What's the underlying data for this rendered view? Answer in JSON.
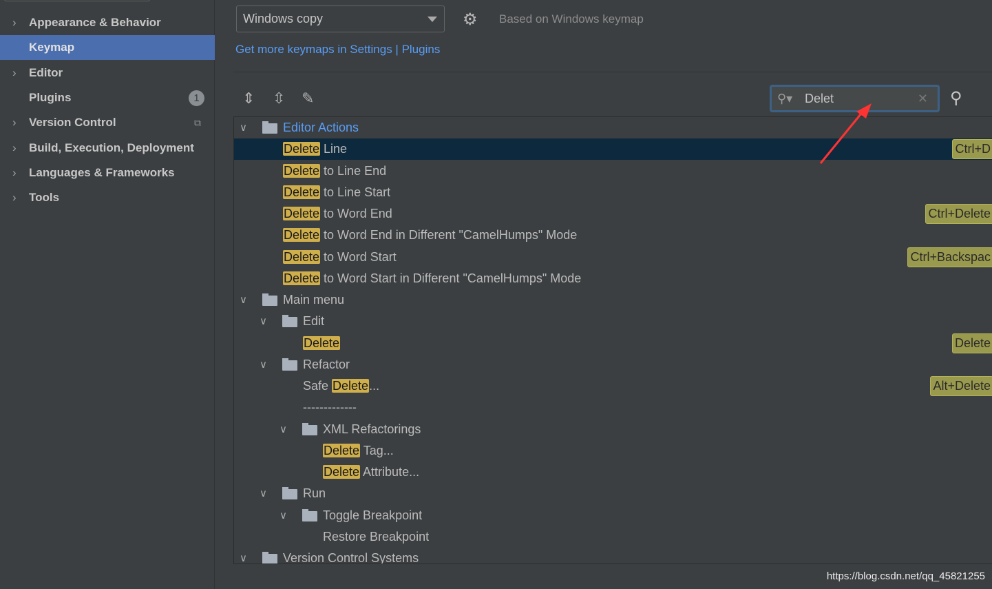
{
  "sidebar": {
    "items": [
      {
        "label": "Appearance & Behavior",
        "expandable": true
      },
      {
        "label": "Keymap",
        "selected": true
      },
      {
        "label": "Editor",
        "expandable": true
      },
      {
        "label": "Plugins",
        "badge": "1"
      },
      {
        "label": "Version Control",
        "expandable": true
      },
      {
        "label": "Build, Execution, Deployment",
        "expandable": true
      },
      {
        "label": "Languages & Frameworks",
        "expandable": true
      },
      {
        "label": "Tools",
        "expandable": true
      }
    ]
  },
  "keymap": {
    "selected": "Windows copy",
    "based_on": "Based on Windows keymap",
    "link": "Get more keymaps in Settings | Plugins"
  },
  "search": {
    "value": "Delet"
  },
  "tree": [
    {
      "level": 0,
      "type": "editor-folder",
      "text": "Editor Actions",
      "blue": true
    },
    {
      "level": 1,
      "type": "leaf",
      "hl": "Delete",
      "rest": " Line",
      "shortcut": "Ctrl+D",
      "selected": true
    },
    {
      "level": 1,
      "type": "leaf",
      "hl": "Delete",
      "rest": " to Line End"
    },
    {
      "level": 1,
      "type": "leaf",
      "hl": "Delete",
      "rest": " to Line Start"
    },
    {
      "level": 1,
      "type": "leaf",
      "hl": "Delete",
      "rest": " to Word End",
      "shortcut": "Ctrl+Delete"
    },
    {
      "level": 1,
      "type": "leaf",
      "hl": "Delete",
      "rest": " to Word End in Different \"CamelHumps\" Mode"
    },
    {
      "level": 1,
      "type": "leaf",
      "hl": "Delete",
      "rest": " to Word Start",
      "shortcut": "Ctrl+Backspac"
    },
    {
      "level": 1,
      "type": "leaf",
      "hl": "Delete",
      "rest": " to Word Start in Different \"CamelHumps\" Mode"
    },
    {
      "level": 0,
      "type": "menu-folder",
      "text": "Main menu"
    },
    {
      "level": 1,
      "type": "folder",
      "text": "Edit"
    },
    {
      "level": 2,
      "type": "leaf",
      "hl": "Delete",
      "rest": "",
      "shortcut": "Delete"
    },
    {
      "level": 1,
      "type": "folder",
      "text": "Refactor"
    },
    {
      "level": 2,
      "type": "leaf",
      "pre": "Safe ",
      "hl": "Delete",
      "rest": "...",
      "shortcut": "Alt+Delete"
    },
    {
      "level": 2,
      "type": "separator",
      "text": "-------------"
    },
    {
      "level": 2,
      "type": "folder",
      "text": "XML Refactorings"
    },
    {
      "level": 3,
      "type": "leaf",
      "hl": "Delete",
      "rest": " Tag..."
    },
    {
      "level": 3,
      "type": "leaf",
      "hl": "Delete",
      "rest": " Attribute..."
    },
    {
      "level": 1,
      "type": "folder",
      "text": "Run"
    },
    {
      "level": 2,
      "type": "folder",
      "text": "Toggle Breakpoint"
    },
    {
      "level": 3,
      "type": "leaf",
      "text": "Restore Breakpoint"
    },
    {
      "level": 0,
      "type": "folder",
      "text": "Version Control Systems"
    }
  ],
  "watermark": "https://blog.csdn.net/qq_45821255",
  "colors": {
    "accent": "#4b6eaf",
    "link": "#589df6",
    "highlight": "#cfae4c",
    "annotation_arrow": "#ff3333"
  }
}
